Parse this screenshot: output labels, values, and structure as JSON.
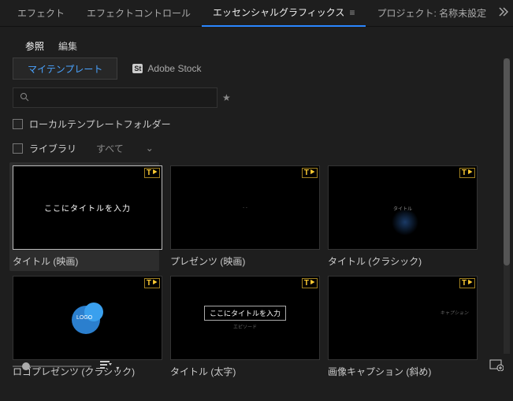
{
  "panelTabs": {
    "effects": "エフェクト",
    "effectControls": "エフェクトコントロール",
    "essentialGraphics": "エッセンシャルグラフィックス",
    "project": "プロジェクト: 名称未設定"
  },
  "subTabs": {
    "browse": "参照",
    "edit": "編集"
  },
  "sourceTabs": {
    "my": "マイテンプレート",
    "stock": "Adobe Stock"
  },
  "search": {
    "placeholder": ""
  },
  "filters": {
    "localFolder": "ローカルテンプレートフォルダー",
    "library": "ライブラリ",
    "libAll": "すべて"
  },
  "templates": [
    {
      "label": "タイトル (映画)",
      "thumbText": "ここにタイトルを入力"
    },
    {
      "label": "プレゼンツ (映画)",
      "thumbText": ""
    },
    {
      "label": "タイトル (クラシック)",
      "thumbText": ""
    },
    {
      "label": "ロゴプレゼンツ (クラシック)",
      "thumbText": ""
    },
    {
      "label": "タイトル (太字)",
      "thumbText": "ここにタイトルを入力",
      "thumbSub": "エピソード"
    },
    {
      "label": "画像キャプション (斜め)",
      "thumbText": ""
    }
  ]
}
